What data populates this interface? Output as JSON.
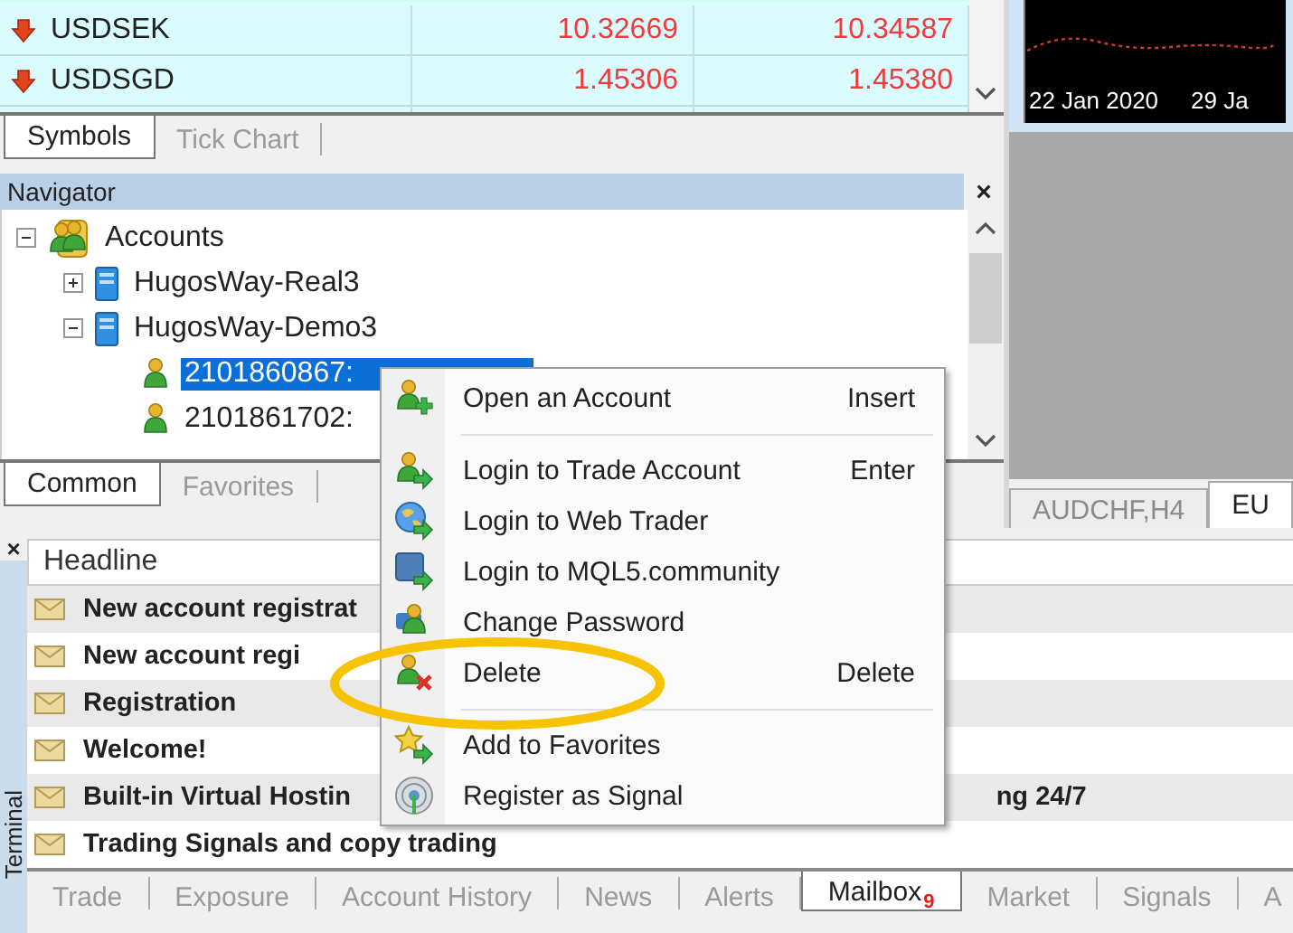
{
  "market_watch": {
    "rows": [
      {
        "symbol": "USDSEK",
        "bid": "10.32669",
        "ask": "10.34587"
      },
      {
        "symbol": "USDSGD",
        "bid": "1.45306",
        "ask": "1.45380"
      }
    ]
  },
  "market_tabs": [
    {
      "label": "Symbols",
      "selected": true
    },
    {
      "label": "Tick Chart",
      "selected": false
    }
  ],
  "chart": {
    "dates": [
      "22 Jan 2020",
      "29 Ja"
    ]
  },
  "chart_tabs": [
    {
      "label": "AUDCHF,H4",
      "selected": false
    },
    {
      "label": "EU",
      "selected": true
    }
  ],
  "navigator": {
    "title": "Navigator",
    "close": "×",
    "tree": [
      {
        "label": "Accounts",
        "expanded": true,
        "selected": false,
        "children": [
          {
            "label": "HugosWay-Real3",
            "expanded": false,
            "selected": false
          },
          {
            "label": "HugosWay-Demo3",
            "expanded": true,
            "selected": false,
            "children": [
              {
                "label": "2101860867:",
                "selected": true
              },
              {
                "label": "2101861702:",
                "selected": false
              }
            ]
          }
        ]
      }
    ]
  },
  "navigator_tabs": [
    {
      "label": "Common",
      "selected": true
    },
    {
      "label": "Favorites",
      "selected": false
    }
  ],
  "terminal": {
    "title": "Terminal",
    "close": "×",
    "column": "Headline",
    "rows": [
      {
        "text": "New account registrat"
      },
      {
        "text": "New account regi"
      },
      {
        "text": "Registration"
      },
      {
        "text": "Welcome!"
      },
      {
        "text": "Built-in Virtual Hostin",
        "text_right": "ng 24/7"
      },
      {
        "text": "Trading Signals and copy trading"
      }
    ]
  },
  "terminal_tabs": [
    {
      "label": "Trade",
      "selected": false
    },
    {
      "label": "Exposure",
      "selected": false
    },
    {
      "label": "Account History",
      "selected": false
    },
    {
      "label": "News",
      "selected": false
    },
    {
      "label": "Alerts",
      "selected": false
    },
    {
      "label": "Mailbox",
      "badge": "9",
      "selected": true
    },
    {
      "label": "Market",
      "selected": false
    },
    {
      "label": "Signals",
      "selected": false
    },
    {
      "label": "A",
      "selected": false
    }
  ],
  "context_menu": [
    {
      "kind": "item",
      "label": "Open an Account",
      "shortcut": "Insert"
    },
    {
      "kind": "separator"
    },
    {
      "kind": "item",
      "label": "Login to Trade Account",
      "shortcut": "Enter"
    },
    {
      "kind": "item",
      "label": "Login to Web Trader"
    },
    {
      "kind": "item",
      "label": "Login to MQL5.community"
    },
    {
      "kind": "item",
      "label": "Change Password"
    },
    {
      "kind": "item",
      "label": "Delete",
      "shortcut": "Delete"
    },
    {
      "kind": "separator"
    },
    {
      "kind": "item",
      "label": "Add to Favorites"
    },
    {
      "kind": "item",
      "label": "Register as Signal"
    }
  ]
}
